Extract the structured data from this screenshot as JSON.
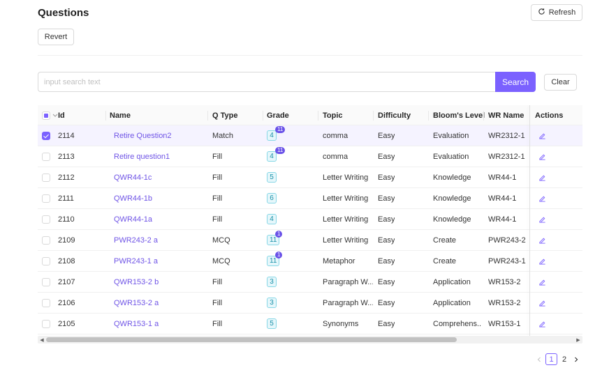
{
  "header": {
    "title": "Questions",
    "refresh_label": "Refresh",
    "revert_label": "Revert"
  },
  "search": {
    "placeholder": "input search text",
    "value": "",
    "search_label": "Search",
    "clear_label": "Clear"
  },
  "table": {
    "columns": {
      "id": "Id",
      "name": "Name",
      "qtype": "Q Type",
      "grade": "Grade",
      "topic": "Topic",
      "difficulty": "Difficulty",
      "bloom": "Bloom's Level",
      "wr": "WR Name",
      "actions": "Actions"
    },
    "rows": [
      {
        "id": "2114",
        "name": "Retire Question2",
        "qtype": "Match",
        "grade": "4",
        "badge": "11",
        "topic": "comma",
        "difficulty": "Easy",
        "bloom": "Evaluation",
        "wr": "WR2312-1",
        "selected": true
      },
      {
        "id": "2113",
        "name": "Retire question1",
        "qtype": "Fill",
        "grade": "4",
        "badge": "11",
        "topic": "comma",
        "difficulty": "Easy",
        "bloom": "Evaluation",
        "wr": "WR2312-1",
        "selected": false
      },
      {
        "id": "2112",
        "name": "QWR44-1c",
        "qtype": "Fill",
        "grade": "5",
        "badge": "",
        "topic": "Letter Writing",
        "difficulty": "Easy",
        "bloom": "Knowledge",
        "wr": "WR44-1",
        "selected": false
      },
      {
        "id": "2111",
        "name": "QWR44-1b",
        "qtype": "Fill",
        "grade": "6",
        "badge": "",
        "topic": "Letter Writing",
        "difficulty": "Easy",
        "bloom": "Knowledge",
        "wr": "WR44-1",
        "selected": false
      },
      {
        "id": "2110",
        "name": "QWR44-1a",
        "qtype": "Fill",
        "grade": "4",
        "badge": "",
        "topic": "Letter Writing",
        "difficulty": "Easy",
        "bloom": "Knowledge",
        "wr": "WR44-1",
        "selected": false
      },
      {
        "id": "2109",
        "name": "PWR243-2 a",
        "qtype": "MCQ",
        "grade": "11",
        "badge": "1",
        "topic": "Letter Writing",
        "difficulty": "Easy",
        "bloom": "Create",
        "wr": "PWR243-2",
        "selected": false
      },
      {
        "id": "2108",
        "name": "PWR243-1 a",
        "qtype": "MCQ",
        "grade": "11",
        "badge": "1",
        "topic": "Metaphor",
        "difficulty": "Easy",
        "bloom": "Create",
        "wr": "PWR243-1",
        "selected": false
      },
      {
        "id": "2107",
        "name": "QWR153-2 b",
        "qtype": "Fill",
        "grade": "3",
        "badge": "",
        "topic": "Paragraph W...",
        "difficulty": "Easy",
        "bloom": "Application",
        "wr": "WR153-2",
        "selected": false
      },
      {
        "id": "2106",
        "name": "QWR153-2 a",
        "qtype": "Fill",
        "grade": "3",
        "badge": "",
        "topic": "Paragraph W...",
        "difficulty": "Easy",
        "bloom": "Application",
        "wr": "WR153-2",
        "selected": false
      },
      {
        "id": "2105",
        "name": "QWR153-1 a",
        "qtype": "Fill",
        "grade": "5",
        "badge": "",
        "topic": "Synonyms",
        "difficulty": "Easy",
        "bloom": "Comprehens...",
        "wr": "WR153-1",
        "selected": false
      }
    ]
  },
  "pagination": {
    "current": "1",
    "next_page": "2"
  },
  "colors": {
    "accent": "#7b61ff",
    "link": "#6f54e6",
    "grade_tag": "#1890a8",
    "badge": "#6a52e8"
  },
  "icons": {
    "refresh": "refresh-icon",
    "edit": "edit-icon",
    "prev": "chevron-left-icon",
    "next": "chevron-right-icon"
  }
}
